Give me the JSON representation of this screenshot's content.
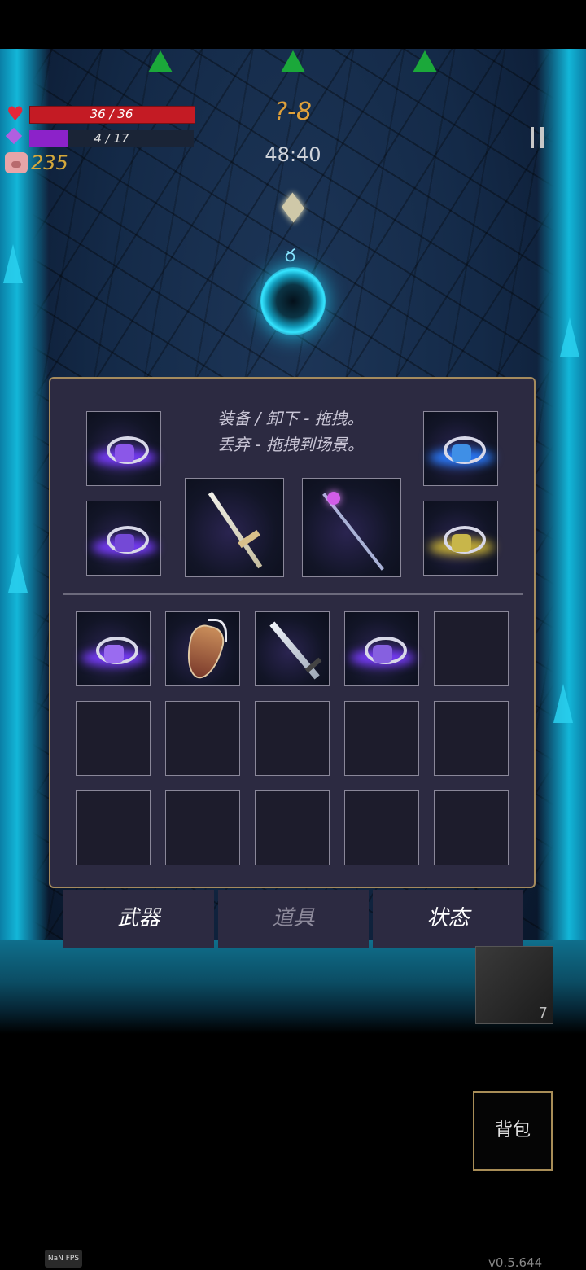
{
  "hud": {
    "hp_text": "36 / 36",
    "hp_fraction": 1.0,
    "mp_text": "4 / 17",
    "mp_fraction": 0.235,
    "coins": "235",
    "stage": "?-8",
    "timer": "48:40"
  },
  "icons": {
    "heart": "heart-icon",
    "gem": "mana-gem-icon",
    "pig": "pig-coin-icon",
    "pause": "pause-icon"
  },
  "inventory": {
    "hint_line1": "装备 / 卸下 - 拖拽。",
    "hint_line2": "丢弃 - 拖拽到场景。",
    "equipped": [
      {
        "slot": "ring-1",
        "item": "purple-ring"
      },
      {
        "slot": "ring-2",
        "item": "purple-ring"
      },
      {
        "slot": "weapon-1",
        "item": "golden-sword"
      },
      {
        "slot": "weapon-2",
        "item": "amethyst-staff"
      },
      {
        "slot": "ring-3",
        "item": "blue-ring"
      },
      {
        "slot": "ring-4",
        "item": "yellow-ring"
      }
    ],
    "bag_items": [
      "purple-flower-ring",
      "winged-shield",
      "steel-sword",
      "purple-spiral-ring"
    ],
    "bag_capacity": 15
  },
  "tabs": [
    {
      "label": "武器",
      "active": true
    },
    {
      "label": "道具",
      "active": false
    },
    {
      "label": "状态",
      "active": false
    }
  ],
  "side": {
    "count": "7"
  },
  "bag_button": "背包",
  "fps": "NaN FPS",
  "version": "v0.5.644",
  "colors": {
    "hp": "#c41b24",
    "mp": "#8c22c9",
    "gold": "#d6a93b",
    "panel": "#2c2a41",
    "panel_border": "#a58b5d"
  }
}
